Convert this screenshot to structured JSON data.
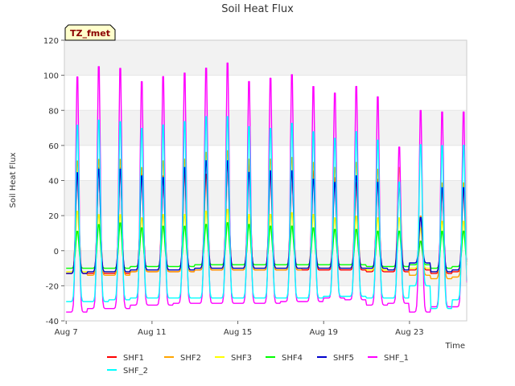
{
  "chart_data": {
    "type": "line",
    "title": "Soil Heat Flux",
    "xlabel": "Time",
    "ylabel": "Soil Heat Flux",
    "badge": "TZ_fmet",
    "ylim": [
      -40,
      120
    ],
    "yticks": [
      -40,
      -20,
      0,
      20,
      40,
      60,
      80,
      100,
      120
    ],
    "xlim": [
      "Aug 6 22:00",
      "Aug 25 16:00"
    ],
    "xticks": [
      "Aug 7",
      "Aug 11",
      "Aug 15",
      "Aug 19",
      "Aug 23"
    ],
    "grid": true,
    "legend_position": "bottom",
    "x": [
      "Aug 7",
      "Aug 8",
      "Aug 9",
      "Aug 10",
      "Aug 11",
      "Aug 12",
      "Aug 13",
      "Aug 14",
      "Aug 15",
      "Aug 16",
      "Aug 17",
      "Aug 18",
      "Aug 19",
      "Aug 20",
      "Aug 21",
      "Aug 22",
      "Aug 23",
      "Aug 24",
      "Aug 25"
    ],
    "series": [
      {
        "name": "SHF1",
        "color": "#ff0000",
        "daily_min": [
          -13,
          -13,
          -13,
          -12,
          -12,
          -12,
          -11,
          -11,
          -11,
          -11,
          -11,
          -11,
          -11,
          -11,
          -12,
          -12,
          -11,
          -13,
          -12
        ],
        "daily_max": [
          46,
          50,
          50,
          46,
          45,
          47,
          46,
          53,
          53,
          46,
          47,
          48,
          44,
          41,
          43,
          39,
          21,
          37,
          37
        ]
      },
      {
        "name": "SHF2",
        "color": "#ffa500",
        "daily_min": [
          -13,
          -14,
          -14,
          -12,
          -12,
          -12,
          -11,
          -11,
          -11,
          -11,
          -11,
          -10,
          -10,
          -10,
          -11,
          -11,
          -14,
          -16,
          -15
        ],
        "daily_max": [
          54,
          55,
          55,
          50,
          54,
          55,
          59,
          60,
          55,
          55,
          56,
          53,
          50,
          53,
          49,
          50,
          21,
          41,
          41
        ]
      },
      {
        "name": "SHF3",
        "color": "#ffff00",
        "daily_min": [
          -12,
          -12,
          -12,
          -11,
          -11,
          -11,
          -10,
          -10,
          -10,
          -10,
          -10,
          -10,
          -10,
          -10,
          -11,
          -11,
          -10,
          -12,
          -11
        ],
        "daily_max": [
          24,
          22,
          22,
          20,
          22,
          22,
          24,
          25,
          22,
          22,
          23,
          22,
          20,
          21,
          20,
          20,
          14,
          18,
          18
        ]
      },
      {
        "name": "SHF4",
        "color": "#00ff00",
        "daily_min": [
          -10,
          -10,
          -10,
          -9,
          -9,
          -9,
          -8,
          -8,
          -8,
          -8,
          -8,
          -8,
          -8,
          -8,
          -9,
          -9,
          -8,
          -10,
          -9
        ],
        "daily_max": [
          12,
          16,
          17,
          14,
          15,
          15,
          16,
          17,
          16,
          15,
          15,
          14,
          13,
          13,
          12,
          12,
          6,
          12,
          12
        ]
      },
      {
        "name": "SHF5",
        "color": "#0000cd",
        "daily_min": [
          -13,
          -12,
          -12,
          -11,
          -11,
          -11,
          -10,
          -10,
          -10,
          -10,
          -10,
          -10,
          -10,
          -10,
          -10,
          -11,
          -7,
          -12,
          -11
        ],
        "daily_max": [
          47,
          49,
          49,
          45,
          44,
          50,
          54,
          54,
          47,
          48,
          48,
          43,
          41,
          45,
          41,
          41,
          20,
          38,
          38
        ]
      },
      {
        "name": "SHF_1",
        "color": "#ff00ff",
        "daily_min": [
          -35,
          -33,
          -33,
          -31,
          -31,
          -30,
          -30,
          -30,
          -30,
          -30,
          -29,
          -29,
          -27,
          -28,
          -31,
          -30,
          -35,
          -32,
          -32
        ],
        "daily_max": [
          105,
          111,
          110,
          102,
          105,
          107,
          110,
          113,
          102,
          104,
          106,
          99,
          95,
          99,
          93,
          63,
          85,
          84,
          84
        ]
      },
      {
        "name": "SHF_2",
        "color": "#00ffff",
        "daily_min": [
          -29,
          -29,
          -28,
          -27,
          -27,
          -27,
          -27,
          -27,
          -27,
          -27,
          -27,
          -27,
          -26,
          -26,
          -27,
          -27,
          -20,
          -33,
          -28
        ],
        "daily_max": [
          76,
          79,
          78,
          74,
          76,
          78,
          81,
          81,
          75,
          74,
          77,
          72,
          68,
          72,
          67,
          42,
          64,
          64,
          64
        ]
      }
    ]
  }
}
